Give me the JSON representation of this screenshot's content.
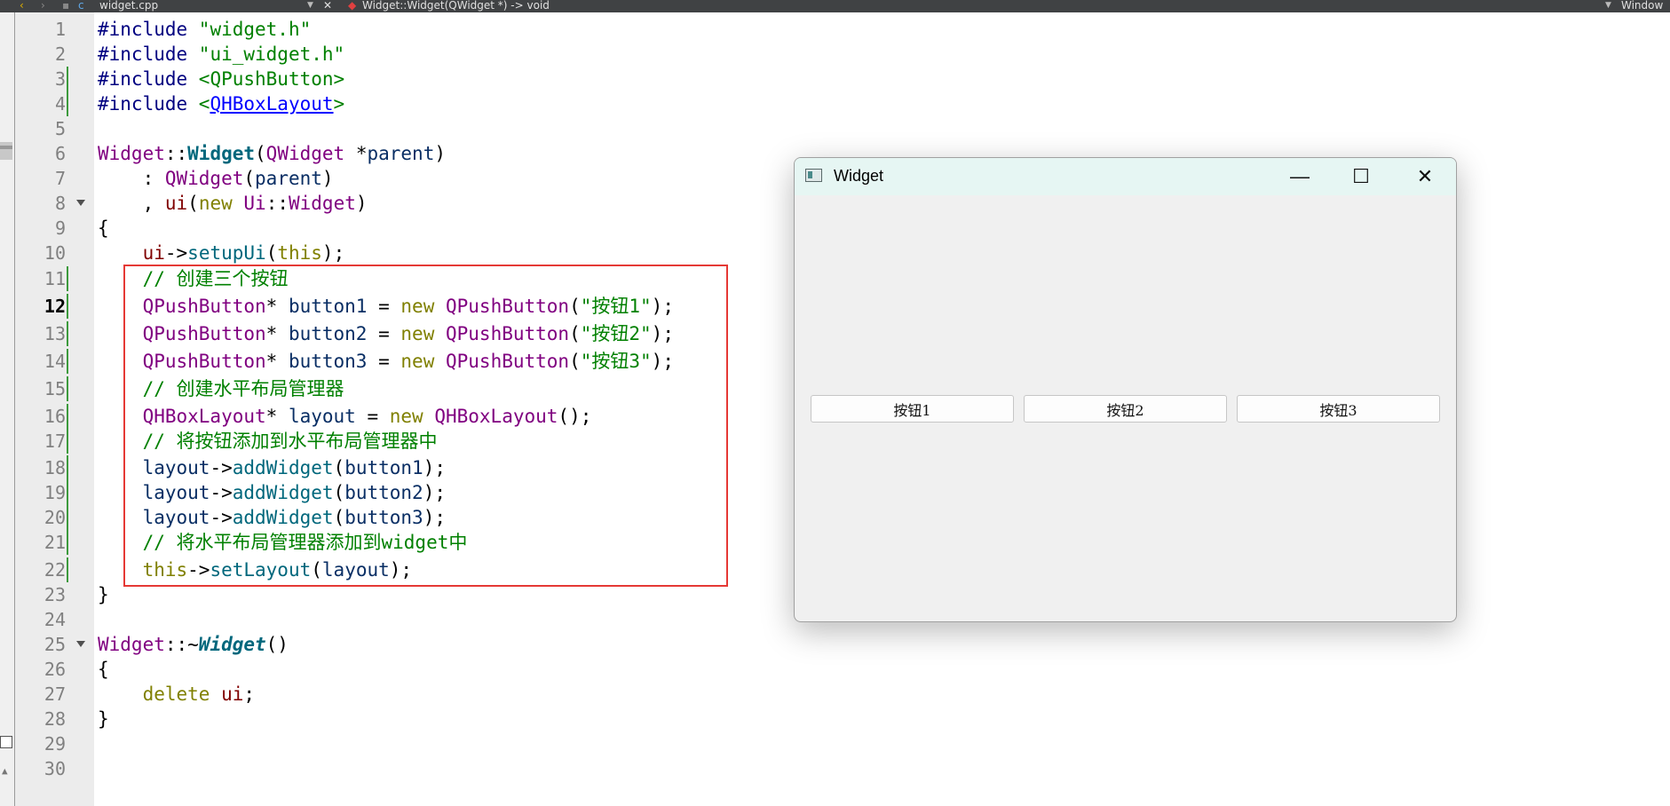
{
  "toolbar": {
    "file_name": "widget.cpp",
    "function_breadcrumb": "Widget::Widget(QWidget *) -> void",
    "right_label": "Window"
  },
  "editor": {
    "current_line": 12,
    "lines": [
      {
        "n": "1",
        "tokens": [
          {
            "t": "#include ",
            "c": "kw-prep"
          },
          {
            "t": "\"widget.h\"",
            "c": "str"
          }
        ]
      },
      {
        "n": "2",
        "tokens": [
          {
            "t": "#include ",
            "c": "kw-prep"
          },
          {
            "t": "\"ui_widget.h\"",
            "c": "str"
          }
        ]
      },
      {
        "n": "3",
        "tokens": [
          {
            "t": "#include ",
            "c": "kw-prep"
          },
          {
            "t": "<QPushButton>",
            "c": "str"
          }
        ]
      },
      {
        "n": "4",
        "tokens": [
          {
            "t": "#include ",
            "c": "kw-prep"
          },
          {
            "t": "<",
            "c": "str"
          },
          {
            "t": "QHBoxLayout",
            "c": "link"
          },
          {
            "t": ">",
            "c": "str"
          }
        ]
      },
      {
        "n": "5",
        "tokens": []
      },
      {
        "n": "6",
        "tokens": [
          {
            "t": "Widget",
            "c": "cls"
          },
          {
            "t": "::"
          },
          {
            "t": "Widget",
            "c": "ctor"
          },
          {
            "t": "("
          },
          {
            "t": "QWidget",
            "c": "cls"
          },
          {
            "t": " *"
          },
          {
            "t": "parent",
            "c": "var"
          },
          {
            "t": ")"
          }
        ]
      },
      {
        "n": "7",
        "tokens": [
          {
            "t": "    : "
          },
          {
            "t": "QWidget",
            "c": "cls"
          },
          {
            "t": "("
          },
          {
            "t": "parent",
            "c": "var"
          },
          {
            "t": ")"
          }
        ]
      },
      {
        "n": "8",
        "tokens": [
          {
            "t": "    , "
          },
          {
            "t": "ui",
            "c": "mem"
          },
          {
            "t": "("
          },
          {
            "t": "new",
            "c": "kw"
          },
          {
            "t": " "
          },
          {
            "t": "Ui",
            "c": "cls"
          },
          {
            "t": "::"
          },
          {
            "t": "Widget",
            "c": "cls"
          },
          {
            "t": ")"
          }
        ]
      },
      {
        "n": "9",
        "tokens": [
          {
            "t": "{"
          }
        ]
      },
      {
        "n": "10",
        "tokens": [
          {
            "t": "    "
          },
          {
            "t": "ui",
            "c": "mem"
          },
          {
            "t": "->"
          },
          {
            "t": "setupUi",
            "c": "fn"
          },
          {
            "t": "("
          },
          {
            "t": "this",
            "c": "kw"
          },
          {
            "t": ");"
          }
        ]
      },
      {
        "n": "11",
        "tokens": [
          {
            "t": "    // 创建三个按钮",
            "c": "cmt"
          }
        ]
      },
      {
        "n": "12",
        "tokens": [
          {
            "t": "    "
          },
          {
            "t": "QPushButton",
            "c": "cls"
          },
          {
            "t": "* "
          },
          {
            "t": "button1",
            "c": "var"
          },
          {
            "t": " = "
          },
          {
            "t": "new",
            "c": "kw"
          },
          {
            "t": " "
          },
          {
            "t": "QPushButton",
            "c": "cls"
          },
          {
            "t": "("
          },
          {
            "t": "\"按钮1\"",
            "c": "str"
          },
          {
            "t": ");"
          }
        ]
      },
      {
        "n": "13",
        "tokens": [
          {
            "t": "    "
          },
          {
            "t": "QPushButton",
            "c": "cls"
          },
          {
            "t": "* "
          },
          {
            "t": "button2",
            "c": "var"
          },
          {
            "t": " = "
          },
          {
            "t": "new",
            "c": "kw"
          },
          {
            "t": " "
          },
          {
            "t": "QPushButton",
            "c": "cls"
          },
          {
            "t": "("
          },
          {
            "t": "\"按钮2\"",
            "c": "str"
          },
          {
            "t": ");"
          }
        ]
      },
      {
        "n": "14",
        "tokens": [
          {
            "t": "    "
          },
          {
            "t": "QPushButton",
            "c": "cls"
          },
          {
            "t": "* "
          },
          {
            "t": "button3",
            "c": "var"
          },
          {
            "t": " = "
          },
          {
            "t": "new",
            "c": "kw"
          },
          {
            "t": " "
          },
          {
            "t": "QPushButton",
            "c": "cls"
          },
          {
            "t": "("
          },
          {
            "t": "\"按钮3\"",
            "c": "str"
          },
          {
            "t": ");"
          }
        ]
      },
      {
        "n": "15",
        "tokens": [
          {
            "t": "    // 创建水平布局管理器",
            "c": "cmt"
          }
        ]
      },
      {
        "n": "16",
        "tokens": [
          {
            "t": "    "
          },
          {
            "t": "QHBoxLayout",
            "c": "cls"
          },
          {
            "t": "* "
          },
          {
            "t": "layout",
            "c": "var"
          },
          {
            "t": " = "
          },
          {
            "t": "new",
            "c": "kw"
          },
          {
            "t": " "
          },
          {
            "t": "QHBoxLayout",
            "c": "cls"
          },
          {
            "t": "();"
          }
        ]
      },
      {
        "n": "17",
        "tokens": [
          {
            "t": "    // 将按钮添加到水平布局管理器中",
            "c": "cmt"
          }
        ]
      },
      {
        "n": "18",
        "tokens": [
          {
            "t": "    "
          },
          {
            "t": "layout",
            "c": "var"
          },
          {
            "t": "->"
          },
          {
            "t": "addWidget",
            "c": "fn"
          },
          {
            "t": "("
          },
          {
            "t": "button1",
            "c": "var"
          },
          {
            "t": ");"
          }
        ]
      },
      {
        "n": "19",
        "tokens": [
          {
            "t": "    "
          },
          {
            "t": "layout",
            "c": "var"
          },
          {
            "t": "->"
          },
          {
            "t": "addWidget",
            "c": "fn"
          },
          {
            "t": "("
          },
          {
            "t": "button2",
            "c": "var"
          },
          {
            "t": ");"
          }
        ]
      },
      {
        "n": "20",
        "tokens": [
          {
            "t": "    "
          },
          {
            "t": "layout",
            "c": "var"
          },
          {
            "t": "->"
          },
          {
            "t": "addWidget",
            "c": "fn"
          },
          {
            "t": "("
          },
          {
            "t": "button3",
            "c": "var"
          },
          {
            "t": ");"
          }
        ]
      },
      {
        "n": "21",
        "tokens": [
          {
            "t": "    // 将水平布局管理器添加到widget中",
            "c": "cmt"
          }
        ]
      },
      {
        "n": "22",
        "tokens": [
          {
            "t": "    "
          },
          {
            "t": "this",
            "c": "kw"
          },
          {
            "t": "->"
          },
          {
            "t": "setLayout",
            "c": "fn"
          },
          {
            "t": "("
          },
          {
            "t": "layout",
            "c": "var"
          },
          {
            "t": ");"
          }
        ]
      },
      {
        "n": "23",
        "tokens": [
          {
            "t": "}"
          }
        ]
      },
      {
        "n": "24",
        "tokens": []
      },
      {
        "n": "25",
        "tokens": [
          {
            "t": "Widget",
            "c": "cls"
          },
          {
            "t": "::~"
          },
          {
            "t": "Widget",
            "c": "dtor"
          },
          {
            "t": "()"
          }
        ]
      },
      {
        "n": "26",
        "tokens": [
          {
            "t": "{"
          }
        ]
      },
      {
        "n": "27",
        "tokens": [
          {
            "t": "    "
          },
          {
            "t": "delete",
            "c": "kw"
          },
          {
            "t": " "
          },
          {
            "t": "ui",
            "c": "mem"
          },
          {
            "t": ";"
          }
        ]
      },
      {
        "n": "28",
        "tokens": [
          {
            "t": "}"
          }
        ]
      },
      {
        "n": "29",
        "tokens": []
      },
      {
        "n": "30",
        "tokens": []
      }
    ]
  },
  "qt_window": {
    "title": "Widget",
    "minimize_glyph": "—",
    "maximize_glyph": "☐",
    "close_glyph": "✕",
    "buttons": [
      "按钮1",
      "按钮2",
      "按钮3"
    ]
  },
  "colors": {
    "highlight_box": "#e53935",
    "title_bar": "#e6f6f3",
    "window_bg": "#f0f0f0"
  }
}
